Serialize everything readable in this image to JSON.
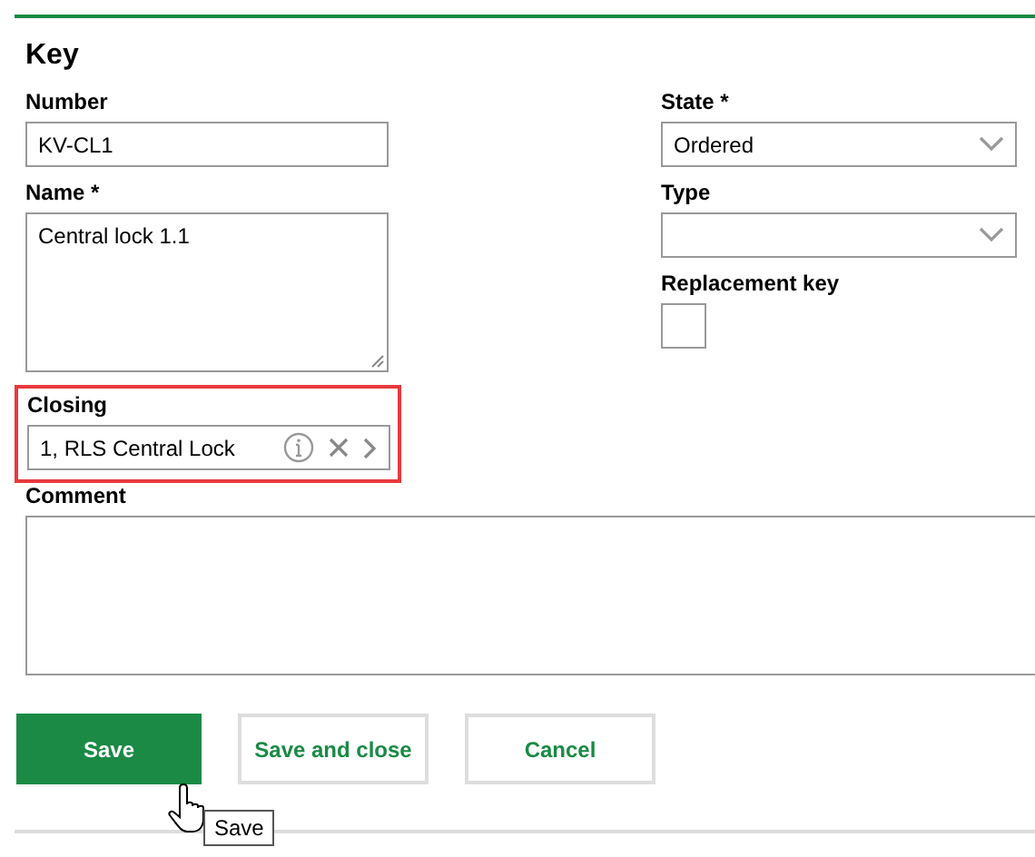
{
  "section": {
    "title": "Key"
  },
  "left_fields": [
    {
      "kind": "text",
      "label": "Number",
      "value": "KV-CL1"
    },
    {
      "kind": "textarea",
      "label": "Name *",
      "value": "Central lock 1.1"
    },
    {
      "kind": "lookup",
      "label": "Closing",
      "value": "1, RLS Central Lock",
      "highlighted": true
    }
  ],
  "right_fields": [
    {
      "kind": "select",
      "label": "State *",
      "value": "Ordered"
    },
    {
      "kind": "select",
      "label": "Type"
    },
    {
      "kind": "checkbox",
      "label": "Replacement key",
      "checked": false
    }
  ],
  "comment": {
    "label": "Comment"
  },
  "buttons": [
    {
      "label": "Save",
      "kind": "primary"
    },
    {
      "label": "Save and close",
      "kind": "secondary"
    },
    {
      "label": "Cancel",
      "kind": "secondary"
    }
  ],
  "tooltip": {
    "text": "Save"
  }
}
